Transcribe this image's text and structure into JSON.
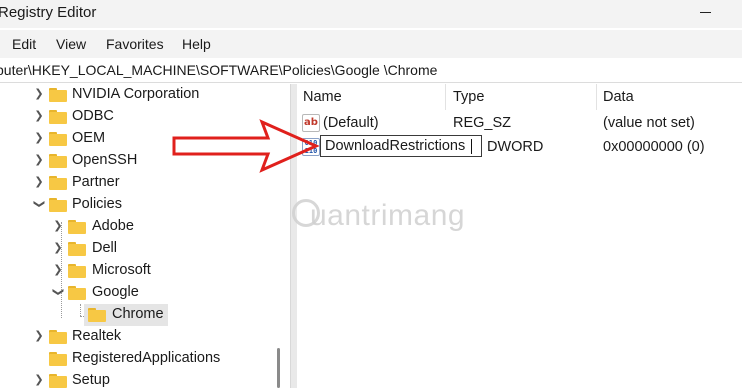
{
  "window": {
    "title": "Registry Editor"
  },
  "menu": [
    "Edit",
    "View",
    "Favorites",
    "Help"
  ],
  "address": {
    "path": "puter\\HKEY_LOCAL_MACHINE\\SOFTWARE\\Policies\\Google \\Chrome"
  },
  "tree": {
    "items": [
      {
        "label": "NVIDIA Corporation",
        "expanded": false
      },
      {
        "label": "ODBC",
        "expanded": false
      },
      {
        "label": "OEM",
        "expanded": false
      },
      {
        "label": "OpenSSH",
        "expanded": false
      },
      {
        "label": "Partner",
        "expanded": false
      },
      {
        "label": "Policies",
        "expanded": true
      },
      {
        "label": "Adobe",
        "expanded": false
      },
      {
        "label": "Dell",
        "expanded": false
      },
      {
        "label": "Microsoft",
        "expanded": false
      },
      {
        "label": "Google",
        "expanded": true
      },
      {
        "label": "Chrome",
        "selected": true
      },
      {
        "label": "Realtek",
        "expanded": false
      },
      {
        "label": "RegisteredApplications",
        "expanded": false
      },
      {
        "label": "Setup",
        "expanded": false
      }
    ]
  },
  "values": {
    "headers": {
      "name": "Name",
      "type": "Type",
      "data": "Data"
    },
    "rows": [
      {
        "icon": "string-value-icon",
        "name": "(Default)",
        "type": "REG_SZ",
        "data": "(value not set)"
      },
      {
        "icon": "dword-value-icon",
        "name": "DownloadRestrictions",
        "type": "DWORD",
        "data": "0x00000000 (0)",
        "editing": true
      }
    ],
    "icon_text": {
      "string": "ab",
      "binary_top": "010",
      "binary_bottom": "110"
    }
  },
  "overlay": {
    "watermark": "uantrimang",
    "arrow_color": "#e0201c"
  },
  "colors": {
    "folder": "#f7c844",
    "selection": "#e5e5e5",
    "chrome_bg": "#f3f3f3"
  }
}
